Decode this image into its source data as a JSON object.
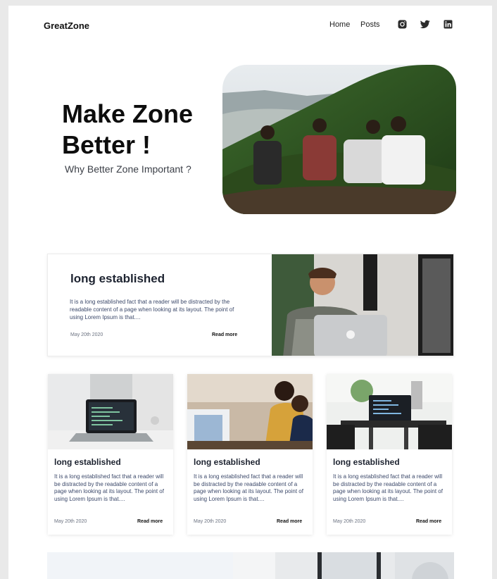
{
  "header": {
    "logo": "GreatZone",
    "nav": {
      "home": "Home",
      "posts": "Posts"
    },
    "social": [
      "instagram-icon",
      "twitter-icon",
      "linkedin-icon"
    ]
  },
  "hero": {
    "title": "Make Zone Better !",
    "subtitle": "Why Better Zone Important ?"
  },
  "featured": {
    "title": "long established",
    "text": "It is a long established fact that a reader will be distracted by the readable content of a page when looking at its layout. The point of using Lorem Ipsum is that....",
    "date": "May 20th 2020",
    "read_more": "Read more"
  },
  "cards": [
    {
      "title": "long established",
      "text": "It is a long established fact that a reader will be distracted by the readable content of a page when looking at its layout. The point of using Lorem Ipsum is that....",
      "date": "May 20th 2020",
      "read_more": "Read more"
    },
    {
      "title": "long established",
      "text": "It is a long established fact that a reader will be distracted by the readable content of a page when looking at its layout. The point of using Lorem Ipsum is that....",
      "date": "May 20th 2020",
      "read_more": "Read more"
    },
    {
      "title": "long established",
      "text": "It is a long established fact that a reader will be distracted by the readable content of a page when looking at its layout. The point of using Lorem Ipsum is that....",
      "date": "May 20th 2020",
      "read_more": "Read more"
    }
  ],
  "colors": {
    "page_bg": "#e9e9e9",
    "card_bg": "#ffffff",
    "title": "#1d2330",
    "body_text": "#3d4a6b"
  }
}
